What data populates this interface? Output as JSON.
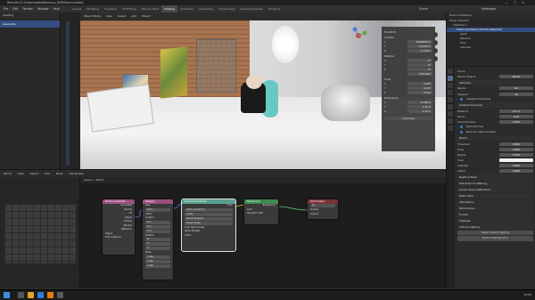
{
  "window": {
    "title": "Blender [C:\\Downloads\\Rebecca_NOEM\\simulated]",
    "controls": [
      "—",
      "▢",
      "✕"
    ]
  },
  "menubar": {
    "items": [
      "File",
      "Edit",
      "Render",
      "Window",
      "Help"
    ],
    "workspace_tabs": [
      "Layout",
      "Modeling",
      "Sculpting",
      "UV Editing",
      "Texture Paint",
      "Shading",
      "Animation",
      "Rendering",
      "Compositing",
      "Geometry Nodes",
      "Scripting"
    ],
    "active_tab": "Shading",
    "scene": "Scene",
    "view_layer": "ViewLayer"
  },
  "left_panel": {
    "header": "Shading",
    "item": "Geometry"
  },
  "viewport": {
    "header_items": [
      "Object Mode",
      "View",
      "Select",
      "Add",
      "Object"
    ],
    "transform": {
      "title": "Transform",
      "location_label": "Location",
      "location": [
        "0.000000 m",
        "-15.440 m",
        "-1.118 m"
      ],
      "rotation_label": "Rotation",
      "rotation": [
        "0°",
        "0°",
        "0°"
      ],
      "mode": "XYZ Euler",
      "scale_label": "Scale",
      "scale": [
        "0.472",
        "0.472",
        "0.472"
      ],
      "dimensions_label": "Dimensions",
      "dimensions": [
        "0.138 m",
        "2.74 m",
        "1.13 m"
      ],
      "properties_button": "Properties"
    }
  },
  "outliner": {
    "title": "Scene Collection",
    "items": [
      "Scene Collection",
      "Collection 1",
      "Studio Apartment | Stockly Styled Set",
      "Lamp",
      "Rebecca",
      "Floor",
      "Cameras"
    ]
  },
  "properties": {
    "context": "Scene",
    "render_engine_label": "Render Engine",
    "render_engine": "Eevee",
    "sampling": {
      "title": "Sampling",
      "render_label": "Render",
      "render": "64",
      "viewport_label": "Viewport",
      "viewport": "16",
      "viewport_denoising": "Viewport Denoising"
    },
    "ambient_occlusion": {
      "title": "Ambient Occlusion",
      "distance_label": "Distance",
      "distance": "0.2 m",
      "factor_label": "Factor",
      "factor": "1.00",
      "trace_precision_label": "Trace Precision",
      "trace_precision": "0.250",
      "bent_normals": "Bent Normals",
      "bounces_approx": "Bounces Approximation"
    },
    "bloom": {
      "title": "Bloom",
      "threshold_label": "Threshold",
      "threshold": "0.800",
      "knee_label": "Knee",
      "knee": "0.500",
      "radius_label": "Radius",
      "radius": "6.500",
      "color_label": "Color",
      "intensity_label": "Intensity",
      "intensity": "0.050",
      "clamp_label": "Clamp",
      "clamp": "0.000"
    },
    "sections": [
      "Depth of Field",
      "Subsurface Scattering",
      "Screen Space Reflections",
      "Motion Blur",
      "Volumetrics",
      "Performance",
      "Curves",
      "Shadows",
      "Indirect Lighting"
    ],
    "bake_button": "Bake Indirect Lighting",
    "bake_cubemap_button": "Bake Cubemap Only"
  },
  "node_editor": {
    "header_items": [
      "World",
      "View",
      "Select",
      "Add",
      "Node",
      "Use Nodes"
    ],
    "breadcrumb": [
      "Scene",
      "World"
    ],
    "nodes": {
      "texcoord": {
        "title": "Texture Coordinate",
        "outputs": [
          "Generated",
          "Normal",
          "UV",
          "Object",
          "Camera",
          "Window",
          "Reflection"
        ],
        "object_label": "Object",
        "from_instancer": "From Instancer"
      },
      "mapping": {
        "title": "Mapping",
        "type_label": "Type",
        "type": "Point",
        "vector_label": "Vector",
        "location_label": "Location",
        "rotation_label": "Rotation",
        "scale_label": "Scale",
        "values": [
          "0 m",
          "0 m",
          "0 m",
          "0°",
          "0°",
          "0°",
          "1.000",
          "1.000",
          "1.000"
        ]
      },
      "env": {
        "title": "Environment Texture",
        "image": "dutch_sunset.hdr",
        "interp": "Linear",
        "proj": "Equirectangular",
        "single": "Single Image",
        "colorspace_label": "Color Space",
        "colorspace": "Linear",
        "alpha_label": "Alpha",
        "alpha": "Straight",
        "vector_label": "Vector",
        "color_out": "Color"
      },
      "background": {
        "title": "Background",
        "out": "Background",
        "color_label": "Color",
        "strength_label": "Strength",
        "strength": "1.000"
      },
      "output": {
        "title": "World Output",
        "target": "All",
        "surface": "Surface",
        "volume": "Volume"
      }
    }
  },
  "taskbar": {
    "time": "12:53"
  },
  "colors": {
    "accent": "#4772b3",
    "node_texcoord": "#9a4f7d",
    "node_mapping": "#9a4f7d",
    "node_env": "#5a9f8d",
    "node_bg": "#3e8a51",
    "node_out": "#7a3438"
  }
}
